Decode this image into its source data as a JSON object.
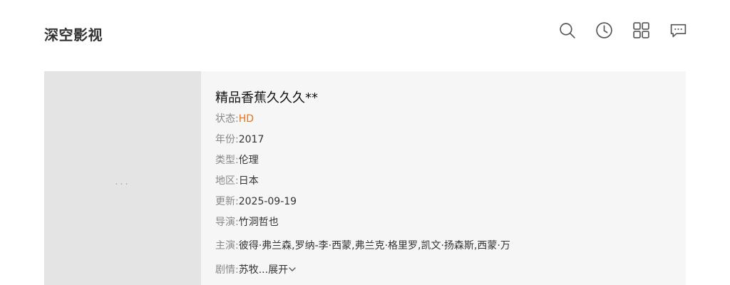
{
  "header": {
    "logo": "深空影视",
    "icons": [
      "search-icon",
      "history-clock-icon",
      "grid-apps-icon",
      "message-icon"
    ]
  },
  "detail": {
    "title": "精品香蕉久久久**",
    "poster_placeholder": "···",
    "fields": [
      {
        "label": "状态:",
        "value": "HD"
      },
      {
        "label": "年份:",
        "value": "2017"
      },
      {
        "label": "类型:",
        "value": "伦理"
      },
      {
        "label": "地区:",
        "value": "日本"
      },
      {
        "label": "更新:",
        "value": "2025-09-19"
      },
      {
        "label": "导演:",
        "value": "竹洞哲也"
      },
      {
        "label": "主演:",
        "value": "彼得·弗兰森,罗纳-李·西蒙,弗兰克·格里罗,凯文·扬森斯,西蒙·万"
      }
    ],
    "plot": {
      "label": "剧情:",
      "value": "苏牧...",
      "expand_label": "展开"
    }
  },
  "colors": {
    "status": "#e8721c",
    "label": "#888888",
    "card_bg": "#f6f6f6",
    "poster_bg": "#e4e4e4"
  }
}
